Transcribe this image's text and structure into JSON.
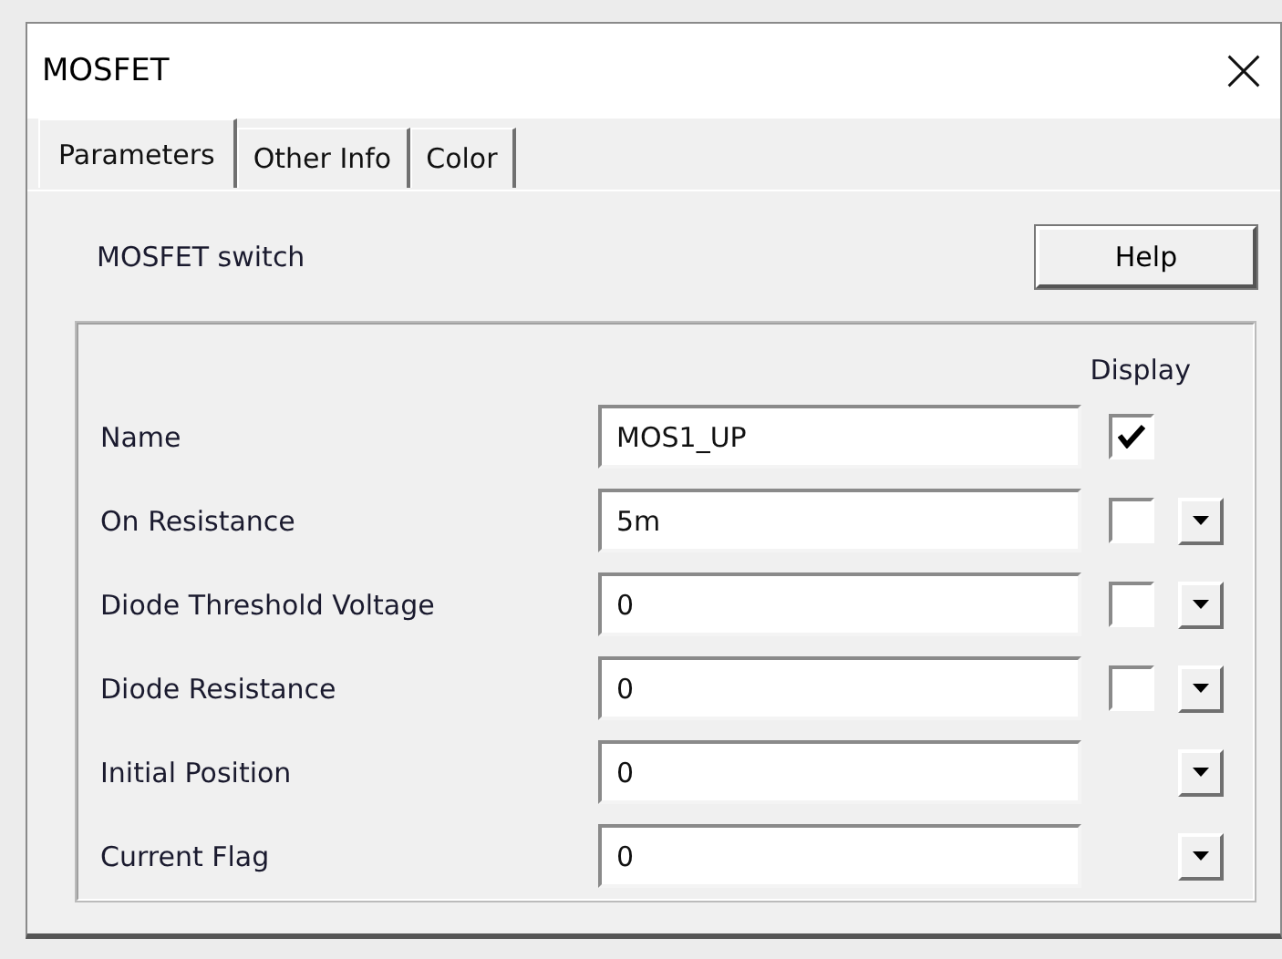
{
  "window": {
    "title": "MOSFET"
  },
  "tabs": [
    {
      "label": "Parameters",
      "selected": true
    },
    {
      "label": "Other Info",
      "selected": false
    },
    {
      "label": "Color",
      "selected": false
    }
  ],
  "description": "MOSFET switch",
  "help_button": "Help",
  "display_heading": "Display",
  "params": [
    {
      "label": "Name",
      "value": "MOS1_UP",
      "checked": true,
      "has_dropdown": false
    },
    {
      "label": "On Resistance",
      "value": "5m",
      "checked": false,
      "has_dropdown": true
    },
    {
      "label": "Diode Threshold Voltage",
      "value": "0",
      "checked": false,
      "has_dropdown": true
    },
    {
      "label": "Diode Resistance",
      "value": "0",
      "checked": false,
      "has_dropdown": true
    },
    {
      "label": "Initial Position",
      "value": "0",
      "has_dropdown": true
    },
    {
      "label": "Current Flag",
      "value": "0",
      "has_dropdown": true
    }
  ]
}
